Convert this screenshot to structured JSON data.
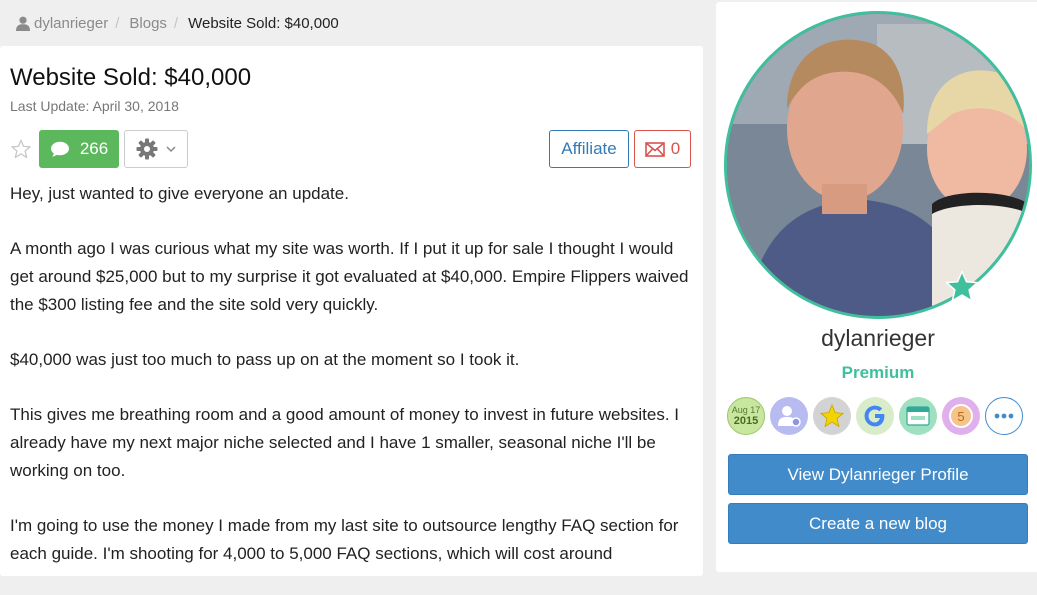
{
  "breadcrumb": {
    "user": "dylanrieger",
    "section": "Blogs",
    "current": "Website Sold: $40,000"
  },
  "post": {
    "title": "Website Sold: $40,000",
    "last_update_label": "Last Update: April 30, 2018",
    "comment_count": "266",
    "affiliate_label": "Affiliate",
    "message_count": "0",
    "paragraphs": [
      "Hey, just wanted to give everyone an update.",
      "A month ago I was curious what my site was worth. If I put it up for sale I thought I would get around $25,000 but to my surprise it got evaluated at $40,000. Empire Flippers waived the $300 listing fee and the site sold very quickly.",
      "$40,000 was just too much to pass up on at the moment so I took it.",
      "This gives me breathing room and a good amount of money to invest in future websites. I already have my next major niche selected and I have 1 smaller, seasonal niche I'll be working on too.",
      "I'm going to use the money I made from my last site to outsource lengthy FAQ section for each guide. I'm shooting for 4,000 to 5,000 FAQ sections, which will cost around"
    ]
  },
  "profile": {
    "username": "dylanrieger",
    "tier": "Premium",
    "badges": {
      "join_month": "Aug 17",
      "join_year": "2015",
      "level_number": "5"
    },
    "view_profile_label": "View Dylanrieger Profile",
    "create_blog_label": "Create a new blog"
  },
  "colors": {
    "green": "#5cb85c",
    "blue": "#428bca",
    "premium": "#3fbf9c",
    "danger": "#d9534f"
  }
}
